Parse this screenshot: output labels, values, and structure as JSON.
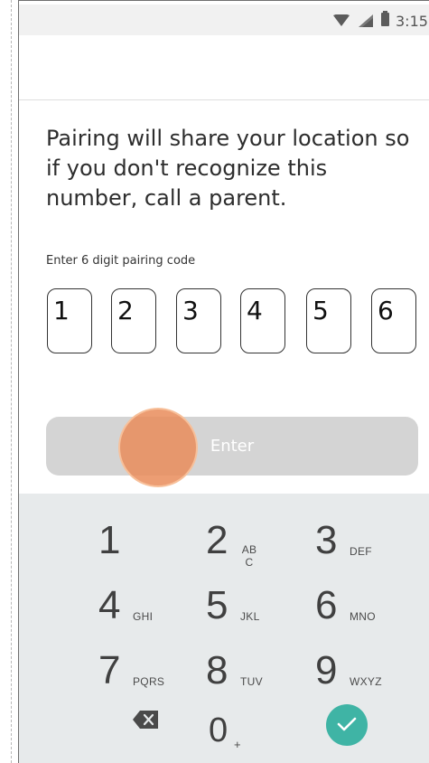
{
  "status_bar": {
    "time": "3:15",
    "icons": [
      "wifi-icon",
      "cellular-signal-icon",
      "battery-icon"
    ]
  },
  "message": "Pairing will share your location so if you don't recognize this number, call a parent.",
  "pairing": {
    "label": "Enter 6 digit pairing code",
    "digits": [
      "1",
      "2",
      "3",
      "4",
      "5",
      "6"
    ]
  },
  "enter_button": {
    "label": "Enter"
  },
  "keypad": {
    "keys": [
      {
        "digit": "1",
        "letters": ""
      },
      {
        "digit": "2",
        "letters": "AB C"
      },
      {
        "digit": "3",
        "letters": "DEF"
      },
      {
        "digit": "4",
        "letters": "GHI"
      },
      {
        "digit": "5",
        "letters": "JKL"
      },
      {
        "digit": "6",
        "letters": "MNO"
      },
      {
        "digit": "7",
        "letters": "PQRS"
      },
      {
        "digit": "8",
        "letters": "TUV"
      },
      {
        "digit": "9",
        "letters": "WXYZ"
      },
      {
        "digit": "0",
        "letters": "+"
      }
    ],
    "backspace_icon": "backspace-icon",
    "done_icon": "checkmark-icon",
    "done_color": "#3fb4a5"
  },
  "colors": {
    "keypad_background": "#e7eaeb",
    "button_disabled": "#d4d4d4",
    "touch_indicator": "#e98c5a"
  }
}
